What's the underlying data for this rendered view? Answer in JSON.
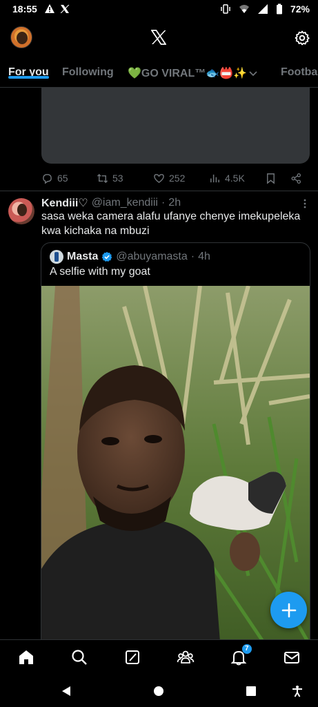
{
  "status_bar": {
    "time": "18:55",
    "battery": "72%",
    "icons": [
      "warning-icon",
      "x-logo-icon",
      "vibrate-icon",
      "wifi-icon",
      "signal-icon",
      "battery-icon"
    ]
  },
  "header": {
    "icons": [
      "profile-avatar",
      "x-logo-icon",
      "settings-gear-icon"
    ]
  },
  "tabs": [
    {
      "label": "For you",
      "active": true
    },
    {
      "label": "Following",
      "active": false
    },
    {
      "label": "💚GO VIRAL™🐟📛✨",
      "active": false
    },
    {
      "label": "Footba",
      "active": false
    }
  ],
  "previous_tweet": {
    "replies": "65",
    "retweets": "53",
    "likes": "252",
    "views": "4.5K"
  },
  "tweet": {
    "name": "Kendiii♡",
    "handle": "@iam_kendiii",
    "time": "2h",
    "text": "sasa weka camera alafu ufanye chenye imekupeleka kwa kichaka na mbuzi",
    "quote": {
      "name": "Masta",
      "handle": "@abuyamasta",
      "time": "4h",
      "text": "A selfie with my goat"
    }
  },
  "fab": {
    "icon": "plus-icon"
  },
  "bottom_nav": {
    "items": [
      "home-icon",
      "search-icon",
      "grok-icon",
      "communities-icon",
      "notifications-icon",
      "messages-icon"
    ],
    "notification_count": "7"
  },
  "colors": {
    "accent": "#1d9bf0",
    "background": "#000000",
    "secondary_text": "#71767b",
    "divider": "#2f3336"
  }
}
